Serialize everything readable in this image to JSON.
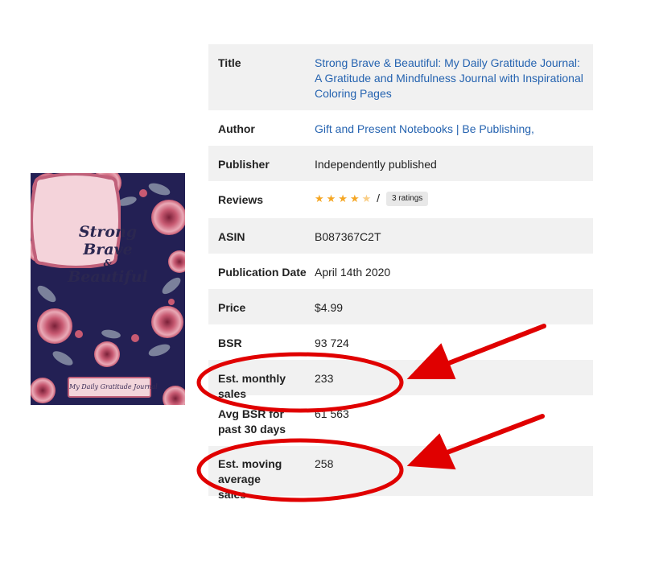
{
  "book": {
    "cover_title_line1": "Strong",
    "cover_title_line2": "Brave",
    "cover_title_amp": "&",
    "cover_title_line3": "Beautiful",
    "cover_subtitle": "My Daily Gratitude Journal"
  },
  "details": [
    {
      "label": "Title",
      "value": "Strong Brave & Beautiful: My Daily Gratitude Journal: A Gratitude and Mindfulness Journal with Inspirational Coloring Pages",
      "link": true
    },
    {
      "label": "Author",
      "value": "Gift and Present Notebooks | Be Publishing,",
      "link": true
    },
    {
      "label": "Publisher",
      "value": "Independently published"
    },
    {
      "label": "Reviews",
      "rating": 4.5,
      "separator": "/",
      "ratings_count": "3 ratings"
    },
    {
      "label": "ASIN",
      "value": "B087367C2T"
    },
    {
      "label": "Publication Date",
      "value": "April 14th 2020"
    },
    {
      "label": "Price",
      "value": "$4.99"
    },
    {
      "label": "BSR",
      "value": "93 724"
    },
    {
      "label": "Est. monthly sales",
      "value": "233"
    },
    {
      "label": "Avg BSR for past 30 days",
      "value": "61 563"
    },
    {
      "label": "Est. moving average sales",
      "value": "258"
    }
  ],
  "colors": {
    "link": "#2563b0",
    "row_shade": "#f1f1f1",
    "annotation": "#e00000",
    "star": "#f5a623",
    "cover_background": "#232054"
  }
}
